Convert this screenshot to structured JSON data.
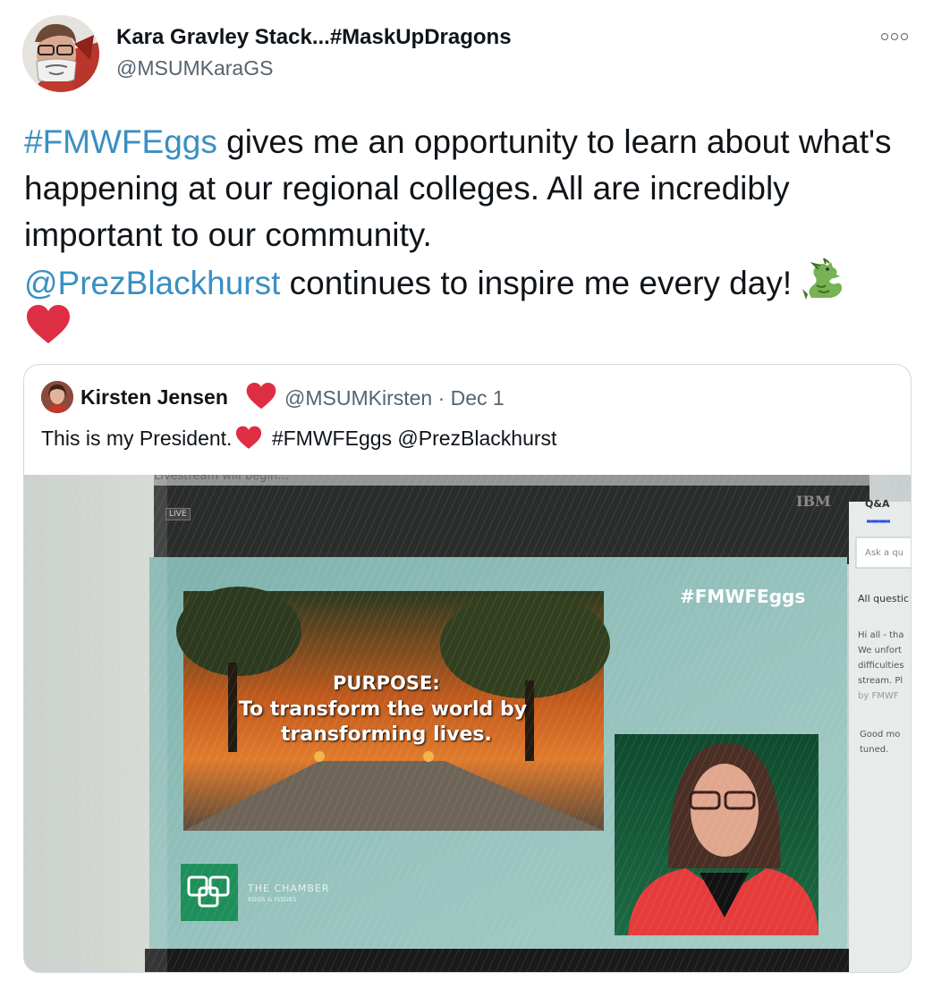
{
  "author": {
    "name": "Kara Gravley Stack...#MaskUpDragons",
    "handle": "@MSUMKaraGS"
  },
  "tweet": {
    "hashtag": "#FMWFEggs",
    "text_1": " gives me an opportunity to learn about what's happening at our regional colleges. All are incredibly important to our community.",
    "mention": "@PrezBlackhurst",
    "text_2": " continues to inspire me every day! ",
    "emoji_dragon": "dragon",
    "emoji_heart": "red-heart"
  },
  "quoted": {
    "name": "Kirsten Jensen",
    "handle_date": "@MSUMKirsten · Dec 1",
    "text_before": "This is my President.",
    "text_after": " #FMWFEggs @PrezBlackhurst"
  },
  "photo": {
    "live_badge": "LIVE",
    "ibm": "IBM",
    "qa_tab": "Q&A",
    "ask_placeholder": "Ask a qu",
    "all_questions": "All questic",
    "side_msg_1": "Hi all - tha",
    "side_msg_2": "We unfort",
    "side_msg_3": "difficulties",
    "side_msg_4": "stream. Pl",
    "side_msg_5": "by FMWF",
    "side_msg_6": "Good mo",
    "side_msg_7": "tuned.",
    "hashtag": "#FMWFEggs",
    "purpose_title": "PURPOSE:",
    "purpose_line1": "To transform the world by",
    "purpose_line2": "transforming lives.",
    "chamber_name": "THE CHAMBER",
    "chamber_sub": "EGGS & ISSUES",
    "top_text": "Livestream will begin..."
  },
  "colors": {
    "link": "#3a8fc2",
    "heart": "#e0245e",
    "text": "#0f1419",
    "muted": "#536471"
  }
}
